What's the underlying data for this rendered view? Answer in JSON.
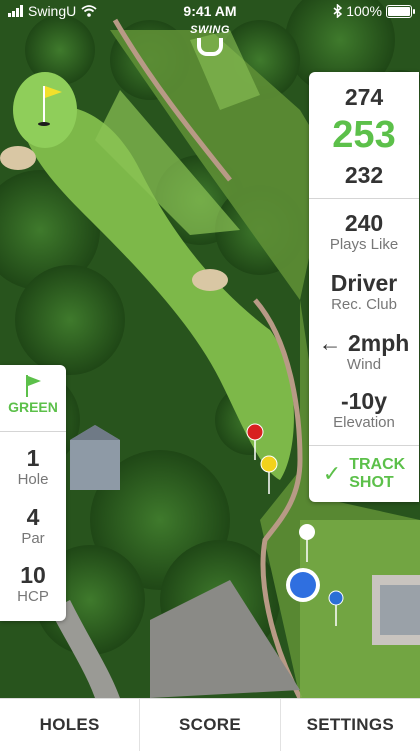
{
  "status_bar": {
    "carrier": "SwingU",
    "time": "9:41 AM",
    "battery": "100%"
  },
  "logo": {
    "text": "SWING",
    "letter": "U"
  },
  "distances": {
    "back": "274",
    "center": "253",
    "front": "232"
  },
  "stats": {
    "plays_like": {
      "value": "240",
      "label": "Plays Like"
    },
    "club": {
      "value": "Driver",
      "label": "Rec. Club"
    },
    "wind": {
      "value": "← 2mph",
      "label": "Wind"
    },
    "elevation": {
      "value": "-10y",
      "label": "Elevation"
    }
  },
  "track_shot": {
    "check": "✓",
    "line1": "TRACK",
    "line2": "SHOT"
  },
  "left_panel": {
    "green_label": "GREEN",
    "hole": {
      "value": "1",
      "label": "Hole"
    },
    "par": {
      "value": "4",
      "label": "Par"
    },
    "hcp": {
      "value": "10",
      "label": "HCP"
    }
  },
  "tabs": [
    "HOLES",
    "SCORE",
    "SETTINGS"
  ],
  "colors": {
    "accent": "#5cc04a",
    "text": "#333333",
    "muted": "#777777"
  },
  "icons": [
    "signal-icon",
    "wifi-icon",
    "bluetooth-icon",
    "battery-icon",
    "flag-icon",
    "check-icon"
  ]
}
